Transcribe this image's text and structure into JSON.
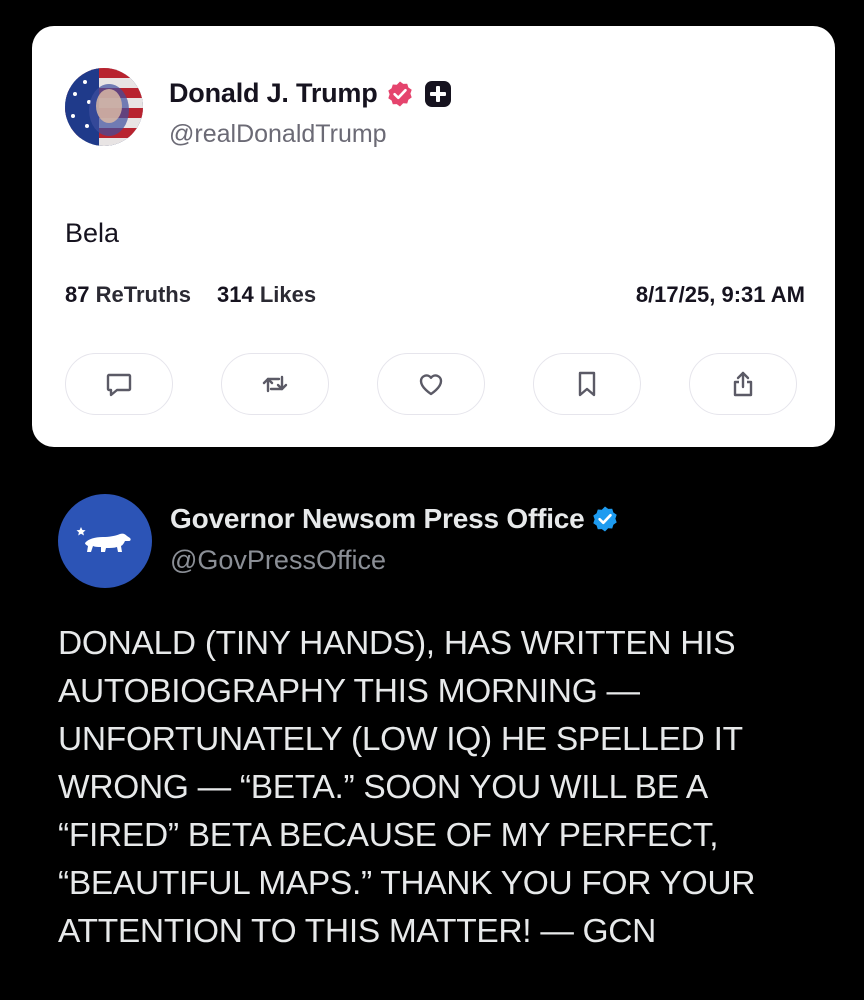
{
  "truth_post": {
    "author_name": "Donald J. Trump",
    "handle": "@realDonaldTrump",
    "text": "Bela",
    "retruths_count": "87",
    "retruths_label": "ReTruths",
    "likes_count": "314",
    "likes_label": "Likes",
    "timestamp": "8/17/25, 9:31 AM",
    "actions": [
      "reply-icon",
      "retruth-icon",
      "like-icon",
      "bookmark-icon",
      "share-icon"
    ],
    "colors": {
      "verified_badge": "#e5446d",
      "card_bg": "#ffffff"
    }
  },
  "gov_post": {
    "author_name": "Governor Newsom Press Office",
    "handle": "@GovPressOffice",
    "lines": [
      "DONALD (TINY HANDS), HAS WRITTEN HIS",
      "AUTOBIOGRAPHY THIS MORNING —",
      "UNFORTUNATELY (LOW IQ) HE SPELLED IT",
      "WRONG — “BETA.” SOON YOU WILL BE A",
      "“FIRED” BETA BECAUSE OF MY PERFECT,",
      "“BEAUTIFUL MAPS.” THANK YOU FOR YOUR",
      "ATTENTION TO THIS MATTER! — GCN"
    ],
    "avatar_icon": "california-bear-icon",
    "colors": {
      "verified_badge": "#1d9bf0",
      "avatar_bg": "#2c54b6",
      "page_bg": "#000000"
    }
  }
}
